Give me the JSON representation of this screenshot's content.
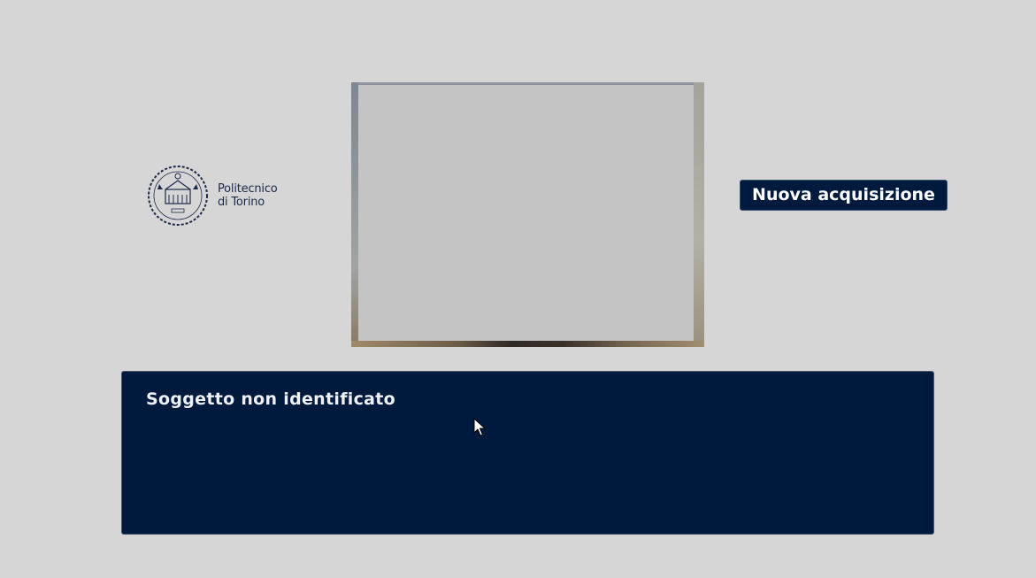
{
  "logo": {
    "name_line1": "Politecnico",
    "name_line2": "di Torino",
    "brand_color": "#1c2a4a"
  },
  "camera": {
    "feed_icon": "camera-preview"
  },
  "actions": {
    "new_acquisition_label": "Nuova acquisizione"
  },
  "result": {
    "status_text": "Soggetto non identificato"
  },
  "colors": {
    "background": "#d6d6d6",
    "primary_navy": "#001a3d",
    "text_light": "#ffffff"
  }
}
